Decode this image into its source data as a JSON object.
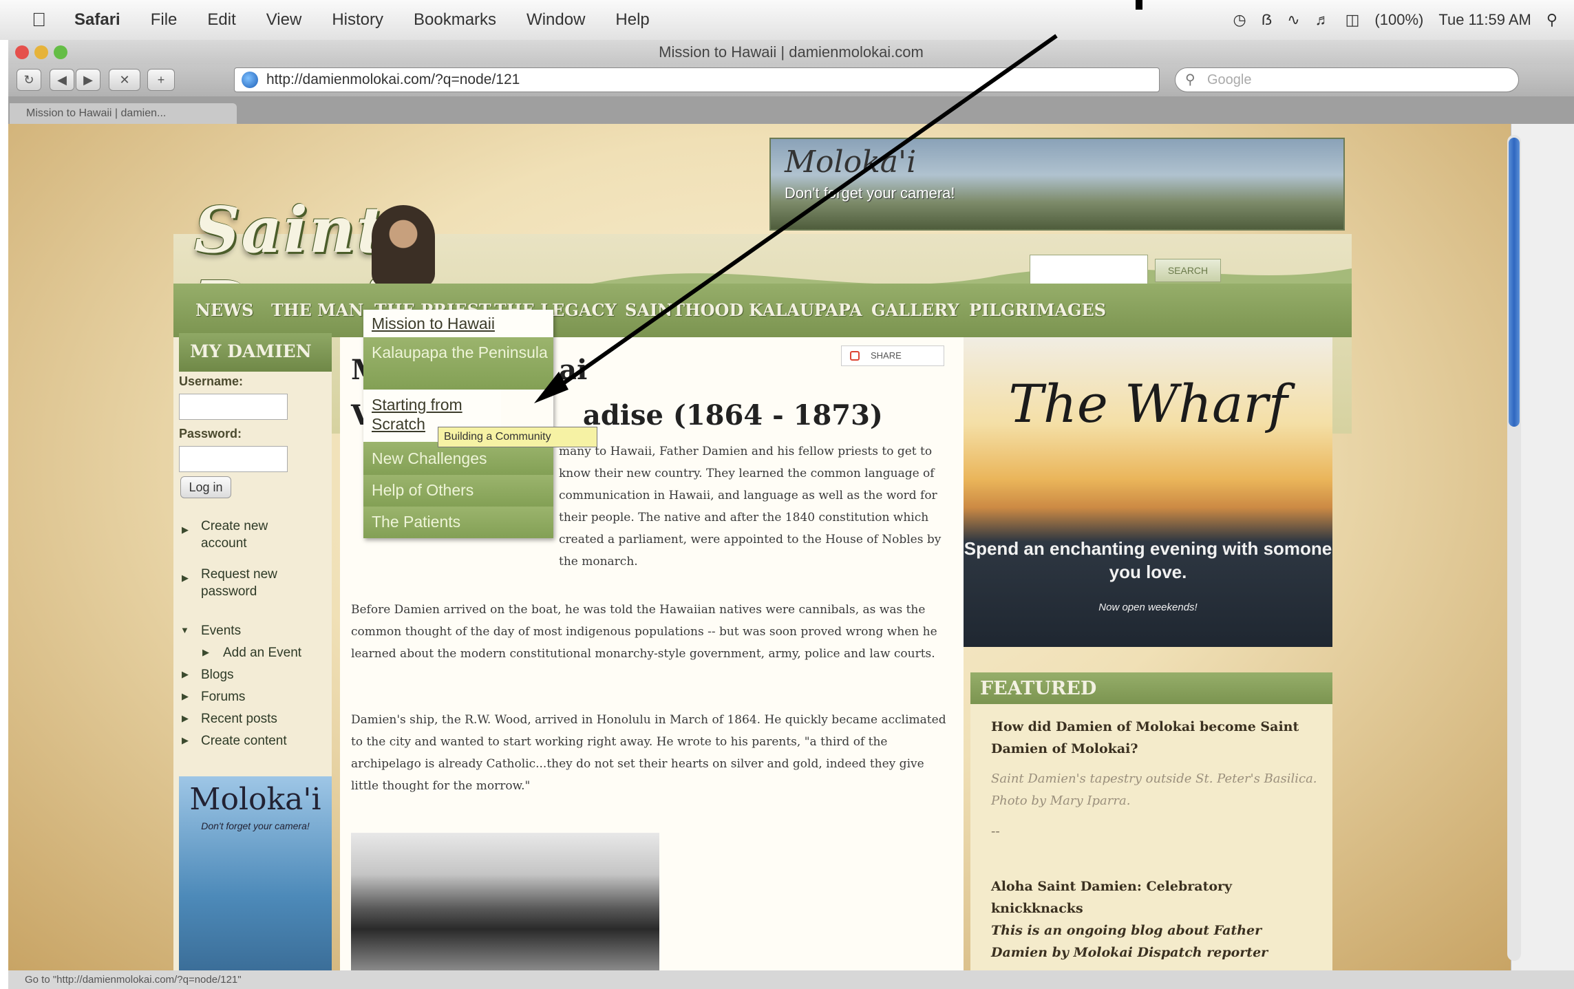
{
  "menubar": {
    "app": "Safari",
    "items": [
      "File",
      "Edit",
      "View",
      "History",
      "Bookmarks",
      "Window",
      "Help"
    ],
    "battery": "(100%)",
    "clock": "Tue 11:59 AM"
  },
  "browser": {
    "window_title": "Mission to Hawaii | damienmolokai.com",
    "url": "http://damienmolokai.com/?q=node/121",
    "search_placeholder": "Google",
    "tab_label": "Mission to Hawaii | damien...",
    "status_text": "Go to \"http://damienmolokai.com/?q=node/121\""
  },
  "site": {
    "logo_text": "Saint Damien",
    "banner": {
      "title": "Moloka'i",
      "subtitle": "Don't forget your camera!"
    },
    "search_button": "SEARCH",
    "nav": [
      "NEWS",
      "THE MAN",
      "THE PRIEST",
      "THE LEGACY",
      "SAINTHOOD",
      "KALAUPAPA",
      "GALLERY",
      "PILGRIMAGES"
    ]
  },
  "dropdown": {
    "items": [
      "Mission to Hawaii",
      "Kalaupapa the Peninsula",
      "Starting from Scratch",
      "New Challenges",
      "Help of Others",
      "The Patients"
    ],
    "tooltip": "Building a Community"
  },
  "sidebar": {
    "title": "MY DAMIEN",
    "username_label": "Username:",
    "password_label": "Password:",
    "login_button": "Log in",
    "links": [
      "Create new account",
      "Request new password",
      "Events",
      "Add an Event",
      "Blogs",
      "Forums",
      "Recent posts",
      "Create content"
    ],
    "ad": {
      "title": "Moloka'i",
      "subtitle": "Don't forget your camera!"
    }
  },
  "article": {
    "share": "SHARE",
    "heading_partial": "M",
    "heading_partial2": "ai",
    "subheading_left": "V",
    "subheading": "adise (1864 - 1873)",
    "para1": "many to Hawaii, Father Damien and his fellow priests to get to know their new country. They learned the common language of communication in Hawaii, and language as well as the word for their people. The native and after the 1840 constitution which created a parliament, were appointed to the House of Nobles by the monarch.",
    "para2": "Before Damien arrived on the boat, he was told the Hawaiian natives were cannibals, as was the common thought of the day of most indigenous populations -- but was soon proved wrong when he learned about the modern constitutional monarchy-style government, army, police and law courts.",
    "para3": "Damien's ship, the R.W. Wood, arrived in Honolulu in March of 1864. He quickly became acclimated to the city and wanted to start working right away. He wrote to his parents, \"a third of the archipelago is already Catholic...they do not set their hearts on silver and gold, indeed they give little thought for the morrow.\""
  },
  "right": {
    "ad_title": "The Wharf",
    "ad_line": "Spend an enchanting evening with somone you love.",
    "ad_note": "Now open weekends!",
    "featured_title": "FEATURED",
    "f1_title": "How did Damien of Molokai become Saint Damien of Molokai?",
    "f1_caption": "Saint Damien's tapestry outside St. Peter's Basilica. Photo by Mary Iparra.",
    "f1_dash": "--",
    "f2_title": "Aloha Saint Damien: Celebratory knickknacks",
    "f2_desc": "This is an ongoing blog about Father Damien by Molokai Dispatch reporter"
  },
  "colors": {
    "nav_green": "#7b9450",
    "arrow": "#000000",
    "tooltip_bg": "#f6f2a4"
  }
}
